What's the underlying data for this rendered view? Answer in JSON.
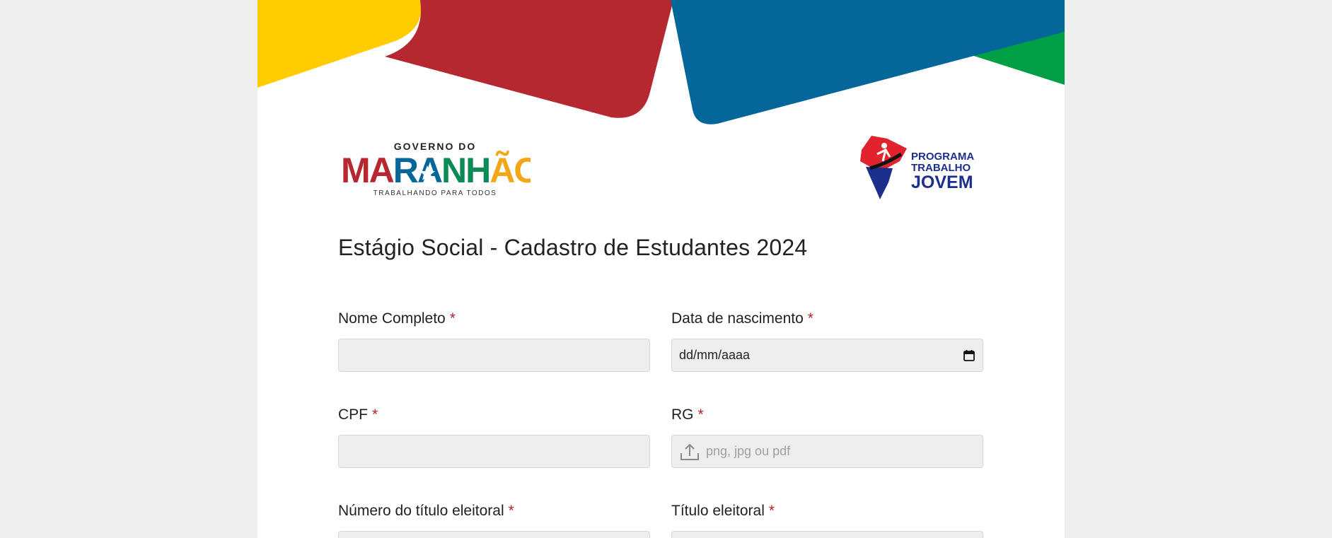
{
  "form": {
    "title": "Estágio Social - Cadastro de Estudantes 2024",
    "required_marker": "*",
    "logos": {
      "left": {
        "line1": "GOVERNO DO",
        "line2": "MARANHÃO",
        "line3": "TRABALHANDO PARA TODOS"
      },
      "right": {
        "line1": "PROGRAMA",
        "line2": "TRABALHO",
        "line3": "JOVEM"
      }
    },
    "fields": {
      "nome": {
        "label": "Nome Completo",
        "value": ""
      },
      "nascimento": {
        "label": "Data de nascimento",
        "value": "dd/mm/aaaa"
      },
      "cpf": {
        "label": "CPF",
        "value": ""
      },
      "rg": {
        "label": "RG",
        "placeholder": "png, jpg ou pdf"
      },
      "titulo_numero": {
        "label": "Número do título eleitoral",
        "value": ""
      },
      "titulo": {
        "label": "Título eleitoral"
      }
    }
  },
  "colors": {
    "background": "#eeeeee",
    "yellow": "#ffcc00",
    "red": "#b5282f",
    "blue": "#046699",
    "green": "#009f45",
    "required": "#b3202a"
  },
  "icons": [
    "calendar-icon",
    "upload-icon"
  ]
}
